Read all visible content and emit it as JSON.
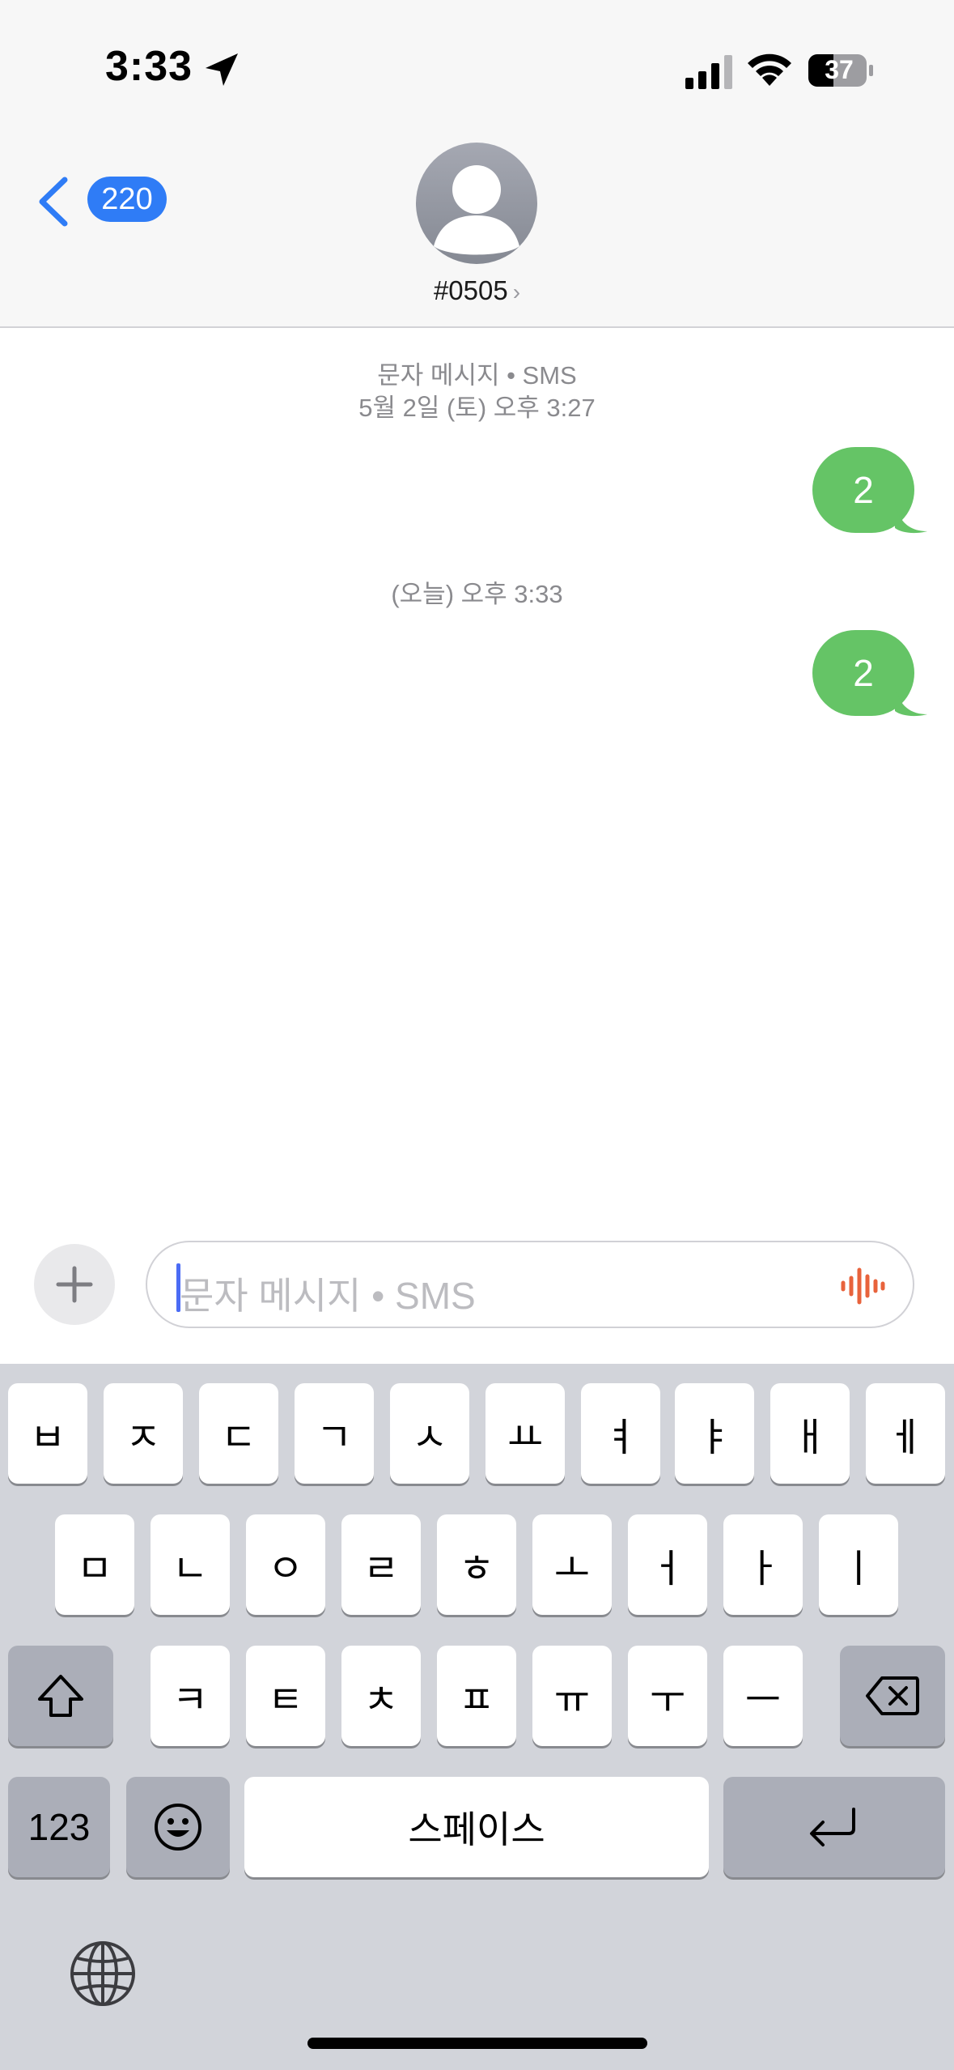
{
  "status_bar": {
    "time": "3:33",
    "battery": "37",
    "icons": [
      "location-arrow-icon",
      "cellular-signal-icon",
      "wifi-icon",
      "battery-icon"
    ]
  },
  "header": {
    "back_badge": "220",
    "contact_name": "#0505",
    "contact_chevron": "›"
  },
  "conversation": {
    "service_label": "문자 메시지 • SMS",
    "first_timestamp": "5월 2일 (토) 오후 3:27",
    "second_timestamp": "(오늘) 오후 3:33",
    "messages": [
      {
        "text": "2",
        "direction": "outgoing"
      },
      {
        "text": "2",
        "direction": "outgoing"
      }
    ],
    "bubble_color": "#65c466"
  },
  "composer": {
    "plus_label": "+",
    "placeholder": "문자 메시지 • SMS",
    "voice_icon": "waveform-icon",
    "voice_color": "#e8633c"
  },
  "keyboard": {
    "row1": [
      "ㅂ",
      "ㅈ",
      "ㄷ",
      "ㄱ",
      "ㅅ",
      "ㅛ",
      "ㅕ",
      "ㅑ",
      "ㅐ",
      "ㅔ"
    ],
    "row2": [
      "ㅁ",
      "ㄴ",
      "ㅇ",
      "ㄹ",
      "ㅎ",
      "ㅗ",
      "ㅓ",
      "ㅏ",
      "ㅣ"
    ],
    "row3": [
      "ㅋ",
      "ㅌ",
      "ㅊ",
      "ㅍ",
      "ㅠ",
      "ㅜ",
      "ㅡ"
    ],
    "numbers_key": "123",
    "space_key": "스페이스",
    "icons": [
      "shift-icon",
      "delete-icon",
      "emoji-icon",
      "return-icon",
      "globe-icon"
    ]
  }
}
